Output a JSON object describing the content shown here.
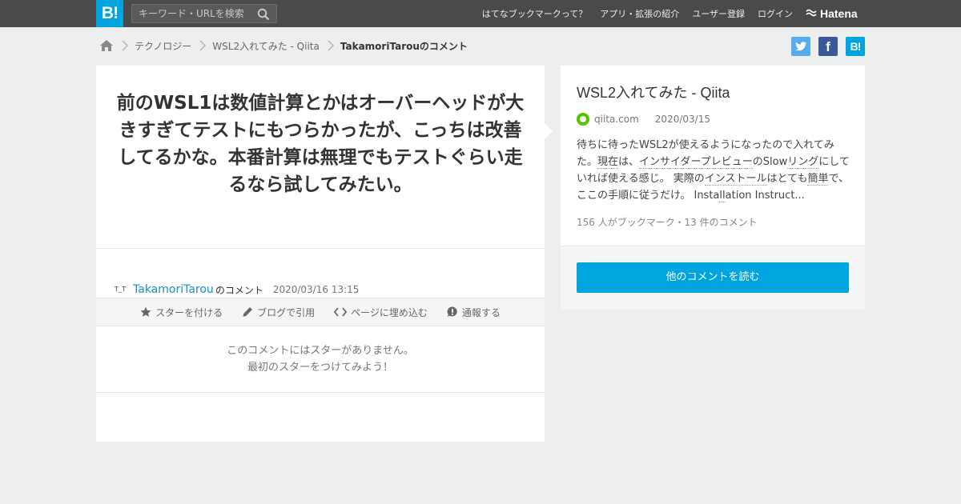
{
  "header": {
    "logo_text": "B!",
    "search_placeholder": "キーワード・URLを検索",
    "nav": [
      "はてなブックマークって？",
      "アプリ・拡張の紹介",
      "ユーザー登録",
      "ログイン"
    ],
    "brand": "Hatena"
  },
  "breadcrumb": {
    "items": [
      "テクノロジー",
      "WSL2入れてみた - Qiita"
    ],
    "current": "TakamoriTarouのコメント"
  },
  "share": {
    "facebook_label": "f",
    "hatena_label": "B!"
  },
  "comment": {
    "text": "前のWSL1は数値計算とかはオーバーヘッドが大きすぎてテストにもつらかったが、こっちは改善してるかな。本番計算は無理でもテストぐらい走るなら試してみたい。",
    "avatar_text": "T_T",
    "user": "TakamoriTarou",
    "user_suffix": "のコメント",
    "date": "2020/03/16 13:15"
  },
  "actions": {
    "star": "スターを付ける",
    "blog": "ブログで引用",
    "embed": "ページに埋め込む",
    "report": "通報する"
  },
  "stars_empty": {
    "line1": "このコメントにはスターがありません。",
    "line2": "最初のスターをつけてみよう！"
  },
  "entry": {
    "title": "WSL2入れてみた - Qiita",
    "domain": "qiita.com",
    "date": "2020/03/15",
    "desc_parts": [
      "待ちに待ったWSL2が使えるようになったので入れてみた。",
      "現在",
      "は、",
      "インサイダープレビュー",
      "の",
      "Slow",
      "リング",
      "にしていれば使える感じ。 実際の",
      "インストール",
      "はとても",
      "簡単",
      "で、ここの手順に従うだけ。 Insta",
      "ll",
      "ation Instruct..."
    ],
    "count": "156 人がブックマーク・13 件のコメント",
    "read_button": "他のコメントを読む"
  },
  "colors": {
    "brand_blue": "#00a4de",
    "twitter": "#55acee",
    "facebook": "#3b5998",
    "qiita_green": "#55c500",
    "link": "#1a8fc2"
  }
}
